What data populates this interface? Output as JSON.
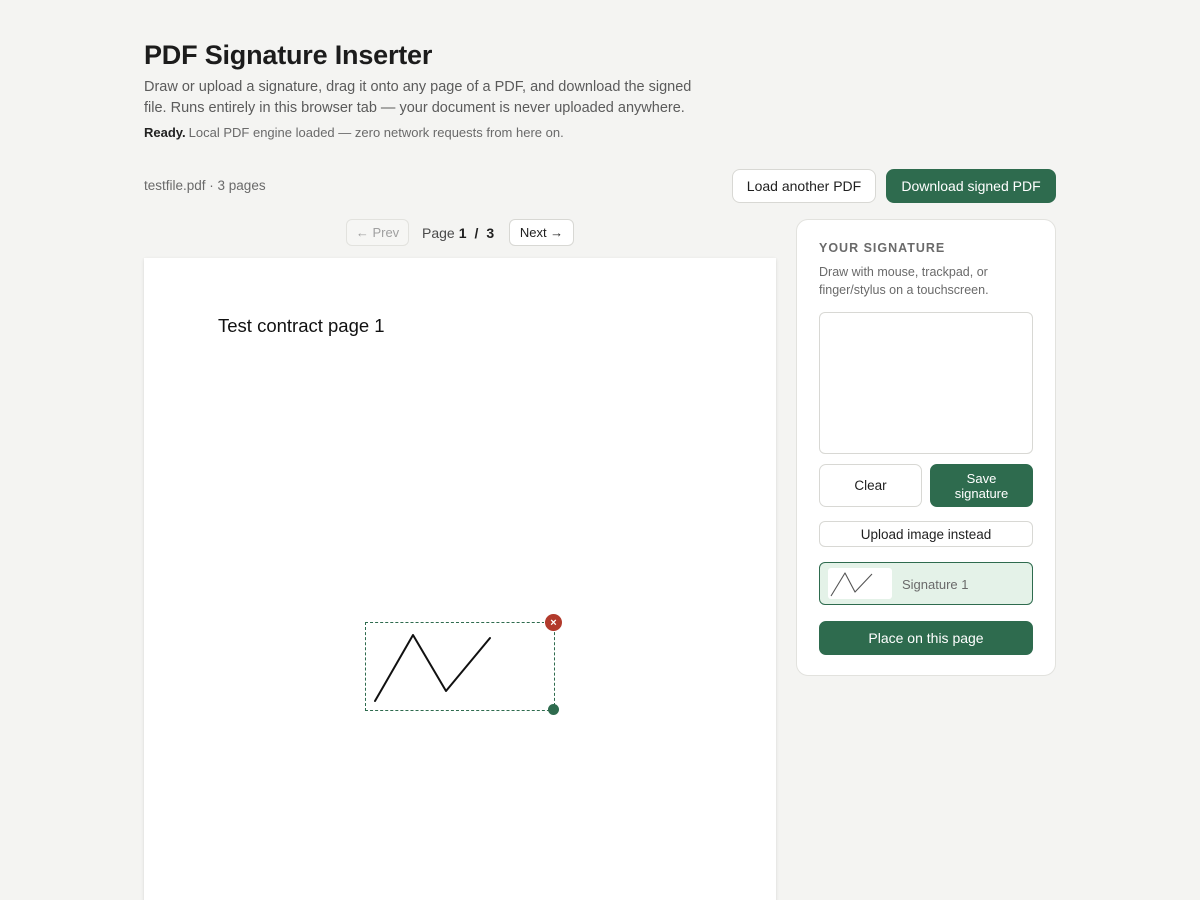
{
  "header": {
    "title": "PDF Signature Inserter",
    "description": "Draw or upload a signature, drag it onto any page of a PDF, and download the signed file. Runs entirely in this browser tab — your document is never uploaded anywhere.",
    "status_strong": "Ready.",
    "status_text": "Local PDF engine loaded — zero network requests from here on."
  },
  "toolbar": {
    "file_info": "testfile.pdf · 3 pages",
    "load_label": "Load another PDF",
    "download_label": "Download signed PDF"
  },
  "pager": {
    "prev_label": "← Prev",
    "page_word": "Page",
    "current": "1",
    "separator": "/",
    "total": "3",
    "next_label": "Next →"
  },
  "document": {
    "page_text": "Test contract page 1",
    "remove_icon": "×"
  },
  "signature_panel": {
    "heading": "YOUR SIGNATURE",
    "subtext": "Draw with mouse, trackpad, or finger/stylus on a touchscreen.",
    "clear_label": "Clear",
    "save_label": "Save signature",
    "upload_label": "Upload image instead",
    "saved": [
      {
        "label": "Signature 1",
        "selected": true
      }
    ],
    "place_label": "Place on this page"
  },
  "colors": {
    "accent": "#2e6b4e",
    "danger": "#b23a2c",
    "background": "#f4f4f2",
    "selected_bg": "#e4f2e8"
  },
  "icons": {
    "remove": "close-icon",
    "resize": "resize-handle-icon"
  }
}
